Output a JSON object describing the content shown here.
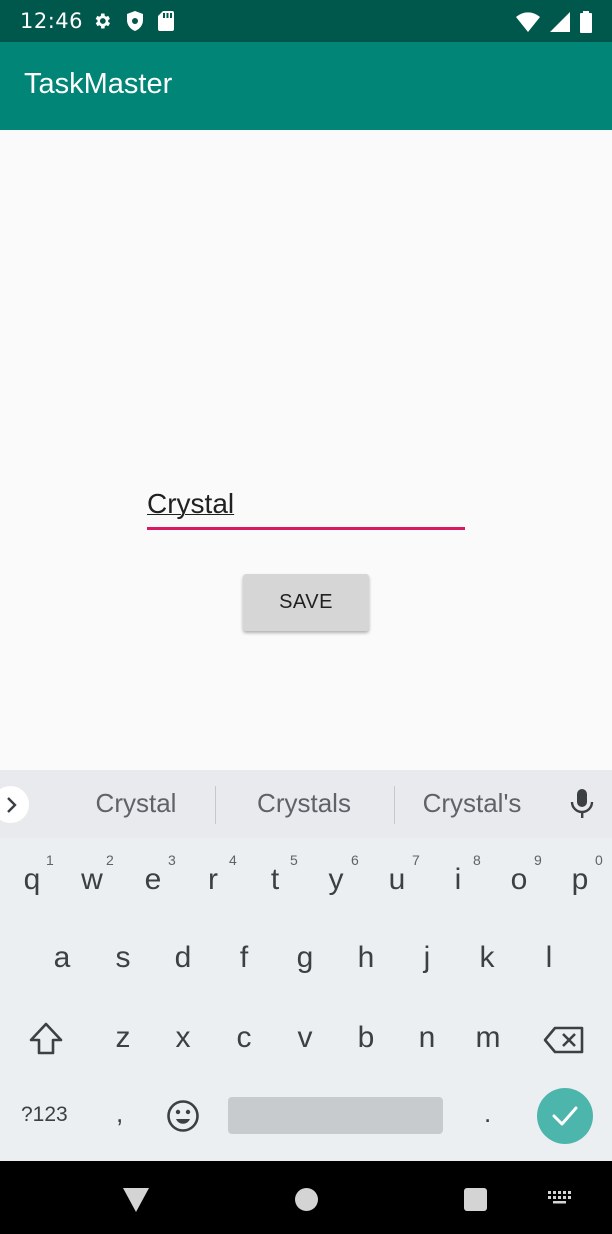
{
  "status_bar": {
    "time": "12:46",
    "left_icons": [
      "gear-icon",
      "shield-icon",
      "sd-card-icon"
    ],
    "right_icons": [
      "wifi-icon",
      "cell-signal-icon",
      "battery-icon"
    ]
  },
  "app_bar": {
    "title": "TaskMaster",
    "color": "#008577",
    "status_color": "#00574b"
  },
  "form": {
    "name_value": "Crystal",
    "underline_color": "#d81b60",
    "save_label": "SAVE"
  },
  "keyboard": {
    "suggestions": [
      "Crystal",
      "Crystals",
      "Crystal's"
    ],
    "row1": [
      "q",
      "w",
      "e",
      "r",
      "t",
      "y",
      "u",
      "i",
      "o",
      "p"
    ],
    "row1_hints": [
      "1",
      "2",
      "3",
      "4",
      "5",
      "6",
      "7",
      "8",
      "9",
      "0"
    ],
    "row2": [
      "a",
      "s",
      "d",
      "f",
      "g",
      "h",
      "j",
      "k",
      "l"
    ],
    "row3": [
      "z",
      "x",
      "c",
      "v",
      "b",
      "n",
      "m"
    ],
    "symbols_label": "?123",
    "comma_label": ",",
    "period_label": ".",
    "done_color": "#4db6ac"
  },
  "nav_bar": {
    "icons": [
      "back-icon",
      "home-icon",
      "recents-icon",
      "keyboard-switch-icon"
    ]
  }
}
